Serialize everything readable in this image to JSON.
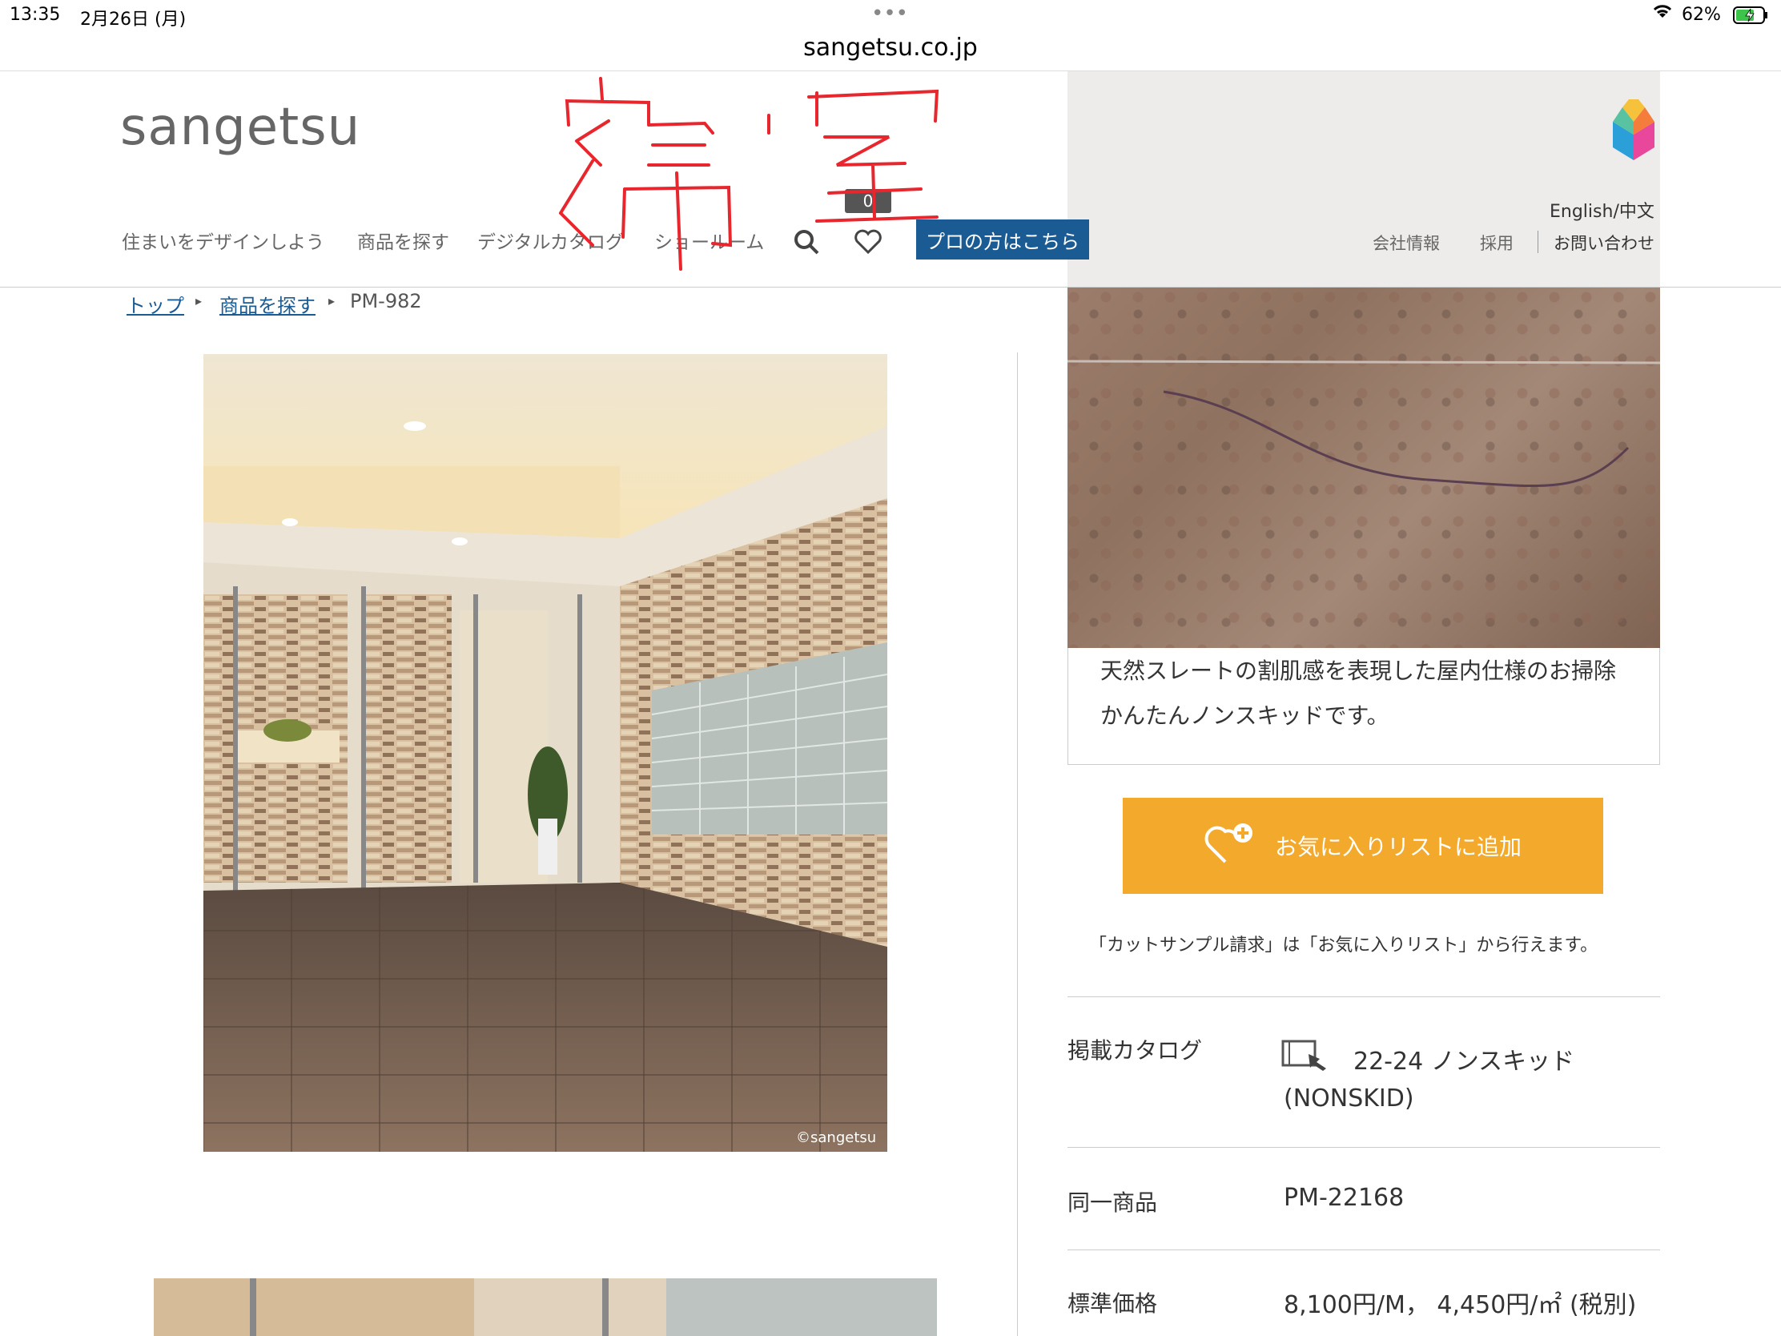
{
  "status_bar": {
    "time": "13:35",
    "date": "2月26日 (月)",
    "battery": "62%",
    "dots": "•••"
  },
  "browser": {
    "url": "sangetsu.co.jp"
  },
  "header": {
    "logo": "sangetsu",
    "nav": [
      "住まいをデザインしよう",
      "商品を探す",
      "デジタルカタログ",
      "ショールーム"
    ],
    "favorites_count": "0",
    "pro_button": "プロの方はこちら",
    "language": "English/中文",
    "utility": [
      "会社情報",
      "採用",
      "お問い合わせ"
    ],
    "handwritten_note": "寝室"
  },
  "breadcrumb": {
    "top": "トップ",
    "search": "商品を探す",
    "current": "PM-982"
  },
  "product": {
    "image_credit": "©sangetsu",
    "description_line1": "天然スレートの割肌感を表現した屋内仕様のお掃除",
    "description_line2": "かんたんノンスキッドです。",
    "favorite_button": "お気に入りリストに追加",
    "sample_note": "「カットサンプル請求」は「お気に入りリスト」から行えます。",
    "specs": {
      "catalog_label": "掲載カタログ",
      "catalog_value_1": "22-24 ノンスキッド",
      "catalog_value_2": "(NONSKID)",
      "same_label": "同一商品",
      "same_value": "PM-22168",
      "price_label": "標準価格",
      "price_value": "8,100円/M， 4,450円/㎡ (税別)"
    }
  },
  "colors": {
    "brand_blue": "#1b5b94",
    "favorite_orange": "#f3a92c",
    "annotation_red": "#e8262d"
  }
}
